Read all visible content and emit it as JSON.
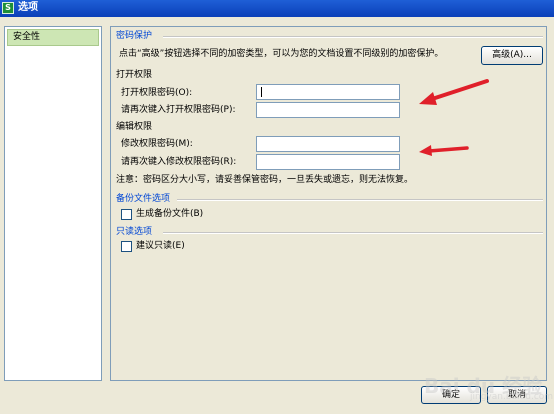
{
  "window": {
    "title": "选项",
    "app_icon_letter": "S"
  },
  "sidebar": {
    "items": [
      {
        "label": "安全性"
      }
    ]
  },
  "password_protection": {
    "heading": "密码保护",
    "description": "点击“高级”按钮选择不同的加密类型，可以为您的文档设置不同级别的加密保护。",
    "advanced_button": "高级(A)..."
  },
  "open_permission": {
    "heading": "打开权限",
    "password_label": "打开权限密码(O):",
    "confirm_label": "请再次键入打开权限密码(P):",
    "password_value": "",
    "confirm_value": ""
  },
  "edit_permission": {
    "heading": "编辑权限",
    "password_label": "修改权限密码(M):",
    "confirm_label": "请再次键入修改权限密码(R):",
    "password_value": "",
    "confirm_value": ""
  },
  "note": "注意：密码区分大小写，请妥善保管密码，一旦丢失或遗忘，则无法恢复。",
  "backup": {
    "heading": "备份文件选项",
    "checkbox_label": "生成备份文件(B)",
    "checked": false
  },
  "readonly": {
    "heading": "只读选项",
    "checkbox_label": "建议只读(E)",
    "checked": false
  },
  "footer": {
    "ok": "确定",
    "cancel": "取消"
  },
  "watermark": {
    "text": "Bai du 经验",
    "sub": "jingyan.baidu.com"
  },
  "colors": {
    "titlebar": "#0a3fb8",
    "section_title": "#0046d5",
    "arrow": "#e0202a",
    "dialog_bg": "#ece9d8"
  }
}
